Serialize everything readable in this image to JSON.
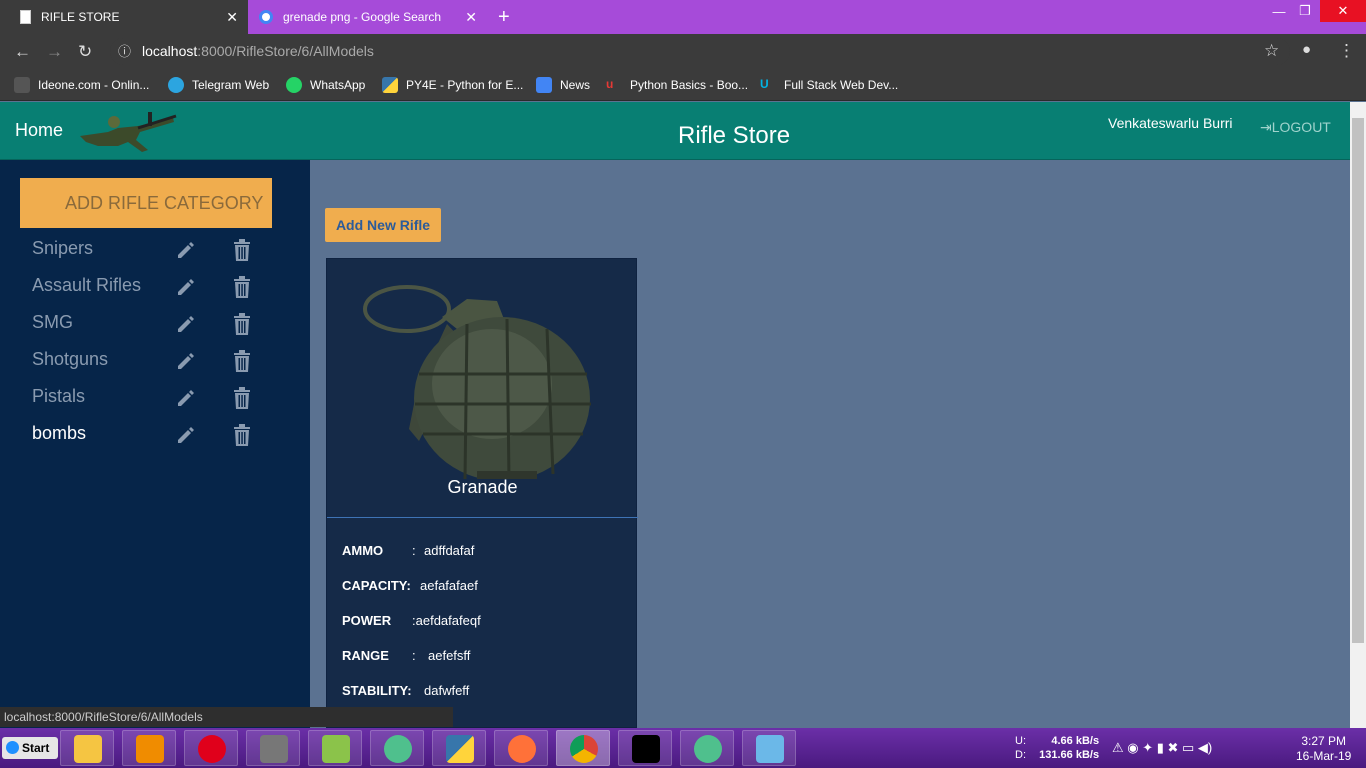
{
  "browser": {
    "tabs": [
      {
        "title": "RIFLE STORE",
        "close": "✕"
      },
      {
        "title": "grenade png - Google Search",
        "close": "✕"
      }
    ],
    "new_tab": "+",
    "window_controls": {
      "minimize": "—",
      "maximize": "❐",
      "close": "✕"
    },
    "address": {
      "host": "localhost",
      "port_path": ":8000/RifleStore/6/AllModels"
    },
    "bookmarks": [
      {
        "label": "Ideone.com - Onlin...",
        "color": "#666666"
      },
      {
        "label": "Telegram Web",
        "color": "#2ca5e0"
      },
      {
        "label": "WhatsApp",
        "color": "#25d366"
      },
      {
        "label": "PY4E - Python for E...",
        "color": "#ffd43b"
      },
      {
        "label": "News",
        "color": "#4285f4"
      },
      {
        "label": "Python Basics - Boo...",
        "color": "#e53935"
      },
      {
        "label": "Full Stack Web Dev...",
        "color": "#02b3e4"
      }
    ]
  },
  "app": {
    "home": "Home",
    "title": "Rifle Store",
    "user": "Venkateswarlu Burri",
    "logout": "LOGOUT",
    "add_category": "ADD RIFLE CATEGORY",
    "categories": [
      {
        "name": "Snipers"
      },
      {
        "name": "Assault Rifles"
      },
      {
        "name": "SMG"
      },
      {
        "name": "Shotguns"
      },
      {
        "name": "Pistals"
      },
      {
        "name": "bombs"
      }
    ],
    "add_rifle": "Add New Rifle",
    "card": {
      "name": "Granade",
      "specs": [
        {
          "label": "AMMO",
          "sep": ":",
          "value": "adffdafaf"
        },
        {
          "label": "CAPACITY:",
          "sep": "",
          "value": "aefafafaef"
        },
        {
          "label": "POWER",
          "sep": ":",
          "value": "aefdafafeqf"
        },
        {
          "label": "RANGE",
          "sep": ":",
          "value": "aefefsff"
        },
        {
          "label": "STABILITY:",
          "sep": "",
          "value": "dafwfeff"
        }
      ]
    }
  },
  "status_url": "localhost:8000/RifleStore/6/AllModels",
  "taskbar": {
    "start": "Start",
    "apps": [
      "explorer",
      "vlc",
      "opera",
      "database",
      "notepad-plus",
      "atom",
      "python",
      "firefox",
      "chrome",
      "cmd",
      "atom",
      "photos"
    ],
    "net": {
      "up_label": "U:",
      "up": "4.66 kB/s",
      "down_label": "D:",
      "down": "131.66 kB/s"
    },
    "time": "3:27 PM",
    "date": "16-Mar-19"
  }
}
